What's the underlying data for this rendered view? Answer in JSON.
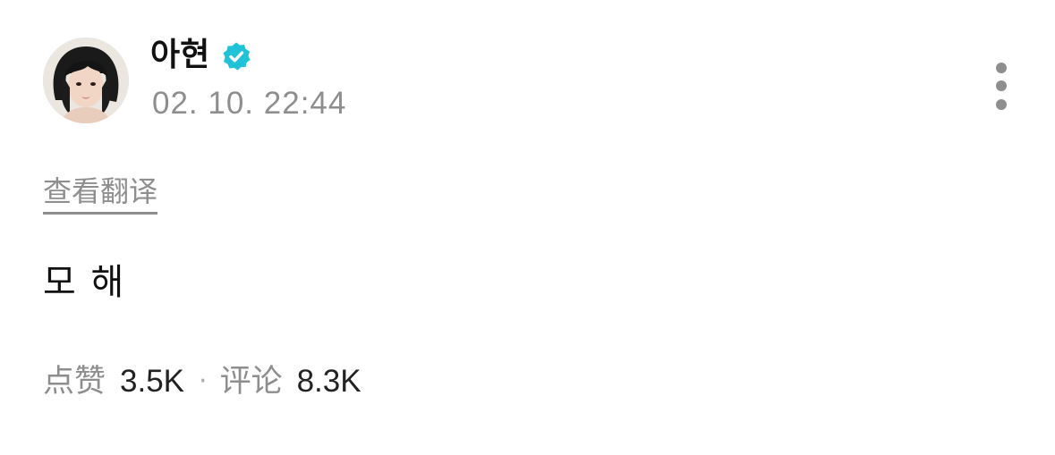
{
  "author": {
    "name": "아현",
    "verified": true,
    "avatar_alt": "profile photo"
  },
  "post": {
    "timestamp": "02. 10. 22:44",
    "translate_label": "查看翻译",
    "body": "모 해"
  },
  "stats": {
    "likes_label": "点赞",
    "likes_value": "3.5K",
    "separator": "·",
    "comments_label": "评论",
    "comments_value": "8.3K"
  },
  "colors": {
    "verified_badge": "#1fc2d6",
    "muted_text": "#8e8e8e",
    "primary_text": "#111111"
  },
  "icons": {
    "verified": "verified-check-icon",
    "more": "more-vertical-icon"
  }
}
